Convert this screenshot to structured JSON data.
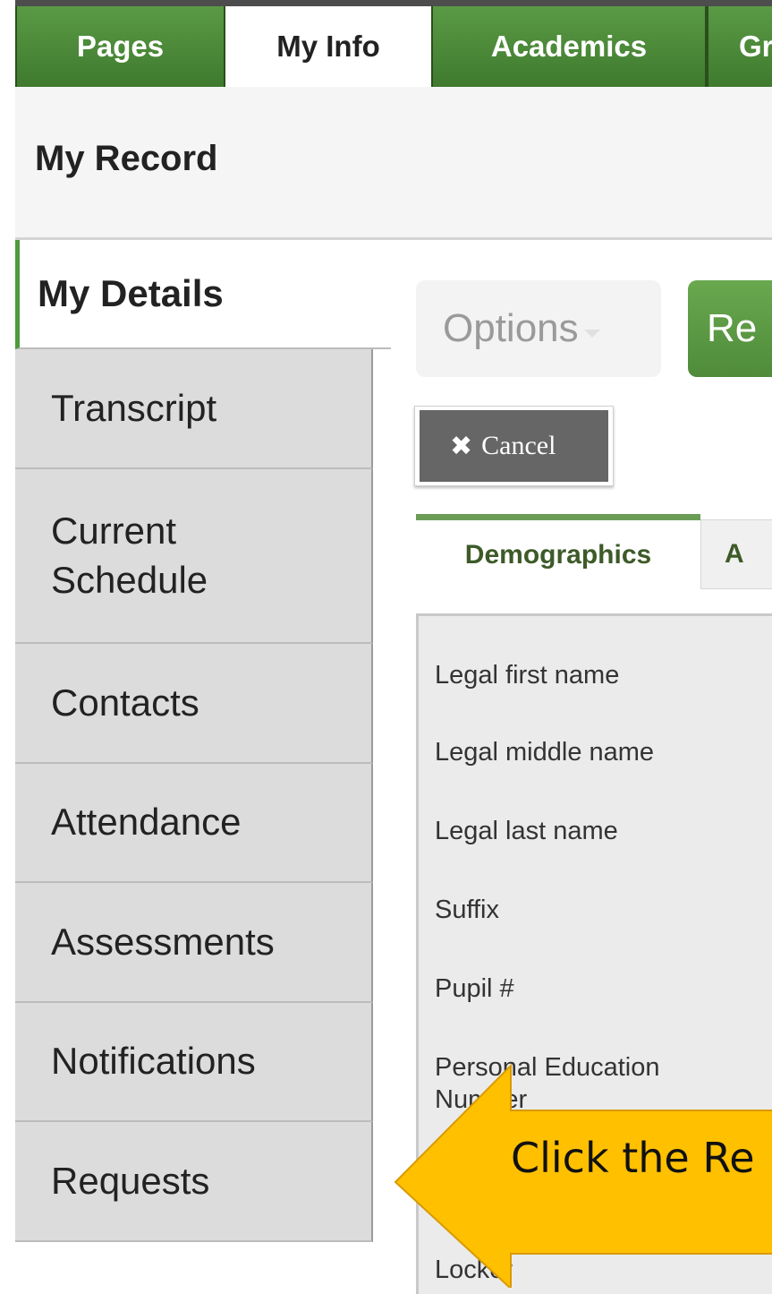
{
  "top_nav": {
    "tabs": [
      "Pages",
      "My Info",
      "Academics",
      "Gr"
    ],
    "active": "My Info"
  },
  "page_title": "My Record",
  "sidebar": {
    "items": [
      {
        "label": "My Details",
        "active": true
      },
      {
        "label": "Transcript"
      },
      {
        "label": "Current Schedule"
      },
      {
        "label": "Contacts"
      },
      {
        "label": "Attendance"
      },
      {
        "label": "Assessments"
      },
      {
        "label": "Notifications"
      },
      {
        "label": "Requests"
      }
    ]
  },
  "toolbar": {
    "options_label": "Options",
    "re_label": "Re",
    "cancel_label": "Cancel"
  },
  "tabs": {
    "demographics": "Demographics",
    "second": "A"
  },
  "form": {
    "labels": [
      "Legal first name",
      "Legal middle name",
      "Legal last name",
      "Suffix",
      "Pupil #",
      "Personal Education Number",
      "Locker"
    ]
  },
  "callout": {
    "text": "Click the Re"
  },
  "colors": {
    "nav_green": "#4f8b3a",
    "active_border": "#4f9a3b",
    "callout_fill": "#ffc000"
  },
  "icons": [
    "close-icon",
    "chevron-down-icon",
    "arrow-left-icon"
  ]
}
